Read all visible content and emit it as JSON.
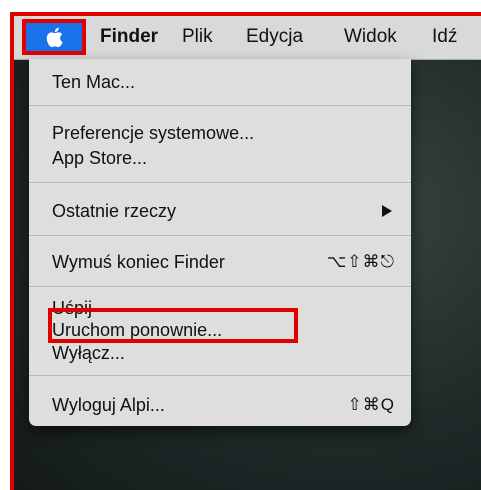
{
  "menubar": {
    "apple_icon": "apple-logo-icon",
    "items": [
      "Finder",
      "Plik",
      "Edycja",
      "Widok",
      "Idź"
    ]
  },
  "apple_menu": {
    "about": "Ten Mac...",
    "system_preferences": "Preferencje systemowe...",
    "app_store": "App Store...",
    "recent_items": "Ostatnie rzeczy",
    "force_quit": "Wymuś koniec Finder",
    "force_quit_shortcut": "⌥⇧⌘⎋",
    "sleep": "Uśpij",
    "restart": "Uruchom ponownie...",
    "shut_down": "Wyłącz...",
    "log_out": "Wyloguj Alpi...",
    "log_out_shortcut": "⇧⌘Q"
  },
  "colors": {
    "annotation": "#e00000",
    "apple_highlight": "#1a72e8",
    "menu_background": "#dededd"
  }
}
